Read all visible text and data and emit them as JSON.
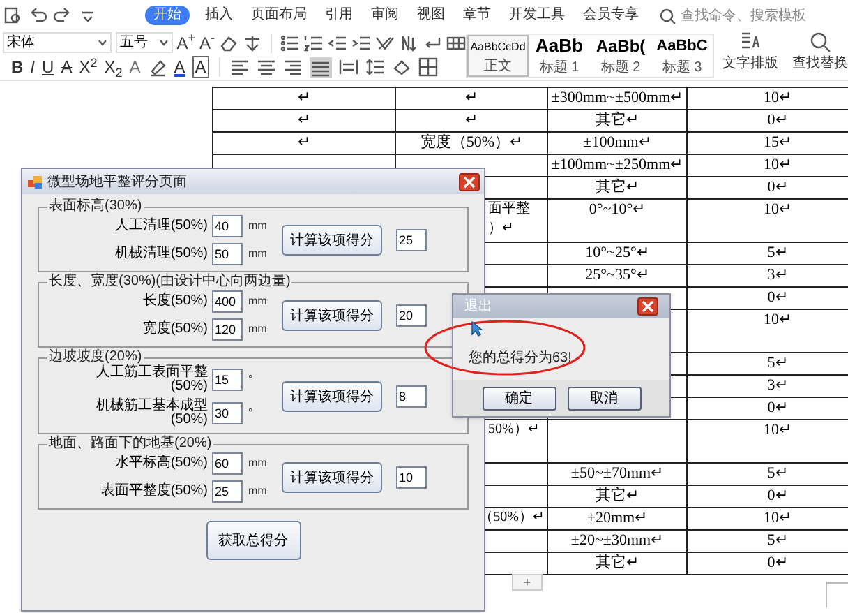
{
  "ribbon": {
    "tabs": [
      {
        "label": "开始",
        "selected": true
      },
      {
        "label": "插入",
        "selected": false
      },
      {
        "label": "页面布局",
        "selected": false
      },
      {
        "label": "引用",
        "selected": false
      },
      {
        "label": "审阅",
        "selected": false
      },
      {
        "label": "视图",
        "selected": false
      },
      {
        "label": "章节",
        "selected": false
      },
      {
        "label": "开发工具",
        "selected": false
      },
      {
        "label": "会员专享",
        "selected": false
      }
    ],
    "search": {
      "placeholder": "查找命令、搜索模板"
    },
    "font": {
      "name": "宋体",
      "size": "五号"
    },
    "size_buttons": [
      "A$^{+}$",
      "A$^{-}$"
    ],
    "format_buttons": [
      {
        "kind": "bold",
        "label": "B"
      },
      {
        "kind": "italic",
        "label": "I"
      },
      {
        "kind": "underline",
        "label": "U"
      },
      {
        "kind": "strike",
        "label": "A"
      },
      {
        "kind": "plain",
        "label": "X$^{2}$"
      },
      {
        "kind": "plain",
        "label": "X$_{2}$"
      },
      {
        "kind": "effect",
        "label": "A"
      },
      {
        "kind": "highlight"
      },
      {
        "kind": "color",
        "label": "A"
      },
      {
        "kind": "boxed",
        "label": "A"
      }
    ],
    "styles": [
      {
        "kind": "body",
        "sample": "AaBbCcDd",
        "name": "正文",
        "selected": true
      },
      {
        "kind": "heading_1",
        "sample": "AaBb",
        "name": "标题 1",
        "selected": false
      },
      {
        "kind": "heading_2",
        "sample": "AaBb(",
        "name": "标题 2",
        "selected": false
      },
      {
        "kind": "heading_3",
        "sample": "AaBbC",
        "name": "标题 3",
        "selected": false
      }
    ],
    "tools": [
      "文字排版",
      "查找替换"
    ]
  },
  "document_table": {
    "rows": [
      {
        "kind": "upper",
        "tall": false,
        "col_1": "↵",
        "col_2": "↵",
        "col_3": "±300mm~±500mm↵",
        "col_4": "10↵"
      },
      {
        "kind": "upper",
        "tall": false,
        "col_1": "↵",
        "col_2": "↵",
        "col_3": "其它↵",
        "col_4": "0↵"
      },
      {
        "kind": "upper",
        "tall": false,
        "col_1": "↵",
        "col_2": "宽度（50%）↵",
        "col_3": "±100mm↵",
        "col_4": "15↵"
      },
      {
        "kind": "upper",
        "tall": false,
        "col_3": "±100mm~±250mm↵",
        "col_4": "10↵"
      },
      {
        "kind": "upper",
        "tall": false,
        "col_3": "其它↵",
        "col_4": "0↵"
      },
      {
        "kind": "lower",
        "tall": true,
        "col_2": "面平整）↵",
        "col_3": "0°~10°↵",
        "col_4": "10↵"
      },
      {
        "kind": "lower",
        "tall": false,
        "col_3": "10°~25°↵",
        "col_4": "5↵"
      },
      {
        "kind": "lower",
        "tall": false,
        "col_3": "25°~35°↵",
        "col_4": "3↵"
      },
      {
        "kind": "lower",
        "tall": false,
        "col_4": "0↵"
      },
      {
        "kind": "lower",
        "tall": true,
        "col_4": "10↵"
      },
      {
        "kind": "lower",
        "tall": false,
        "col_4": "5↵"
      },
      {
        "kind": "lower",
        "tall": false,
        "col_4": "3↵"
      },
      {
        "kind": "lower",
        "tall": false,
        "col_4": "0↵"
      },
      {
        "kind": "lower",
        "tall": true,
        "col_2": "50%）↵",
        "col_4": "10↵"
      },
      {
        "kind": "lower",
        "tall": false,
        "col_3": "±50~±70mm↵",
        "col_4": "5↵"
      },
      {
        "kind": "lower",
        "tall": false,
        "col_3": "其它↵",
        "col_4": "0↵"
      },
      {
        "kind": "lower",
        "tall": false,
        "col_2": "（50%）↵",
        "col_3": "±20mm↵",
        "col_4": "10↵"
      },
      {
        "kind": "lower",
        "tall": false,
        "col_3": "±20~±30mm↵",
        "col_4": "5↵"
      },
      {
        "kind": "lower",
        "tall": false,
        "col_3": "其它↵",
        "col_4": "0↵"
      }
    ],
    "add_row_button": "+"
  },
  "scoring_window": {
    "title": "微型场地平整评分页面",
    "groups": [
      {
        "title": "表面标高(30%)",
        "fields": [
          {
            "label": "人工清理(50%)",
            "value": "40",
            "unit": "mm"
          },
          {
            "label": "机械清理(50%)",
            "value": "50",
            "unit": "mm"
          }
        ],
        "button": "计算该项得分",
        "result": "25"
      },
      {
        "title": "长度、宽度(30%)(由设计中心向两边量)",
        "fields": [
          {
            "label": "长度(50%)",
            "value": "400",
            "unit": "mm"
          },
          {
            "label": "宽度(50%)",
            "value": "120",
            "unit": "mm"
          }
        ],
        "button": "计算该项得分",
        "result": "20"
      },
      {
        "title": "边坡坡度(20%)",
        "fields": [
          {
            "label": "人工筋工表面平整(50%)",
            "value": "15",
            "unit": "°"
          },
          {
            "label": "机械筋工基本成型(50%)",
            "value": "30",
            "unit": "°"
          }
        ],
        "button": "计算该项得分",
        "result": "8"
      },
      {
        "title": "地面、路面下的地基(20%)",
        "fields": [
          {
            "label": "水平标高(50%)",
            "value": "60",
            "unit": "mm"
          },
          {
            "label": "表面平整度(50%)",
            "value": "25",
            "unit": "mm"
          }
        ],
        "button": "计算该项得分",
        "result": "10"
      }
    ],
    "total_button": "获取总得分"
  },
  "message_box": {
    "title": "退出",
    "message": "您的总得分为63!",
    "buttons": [
      "确定",
      "取消"
    ]
  }
}
